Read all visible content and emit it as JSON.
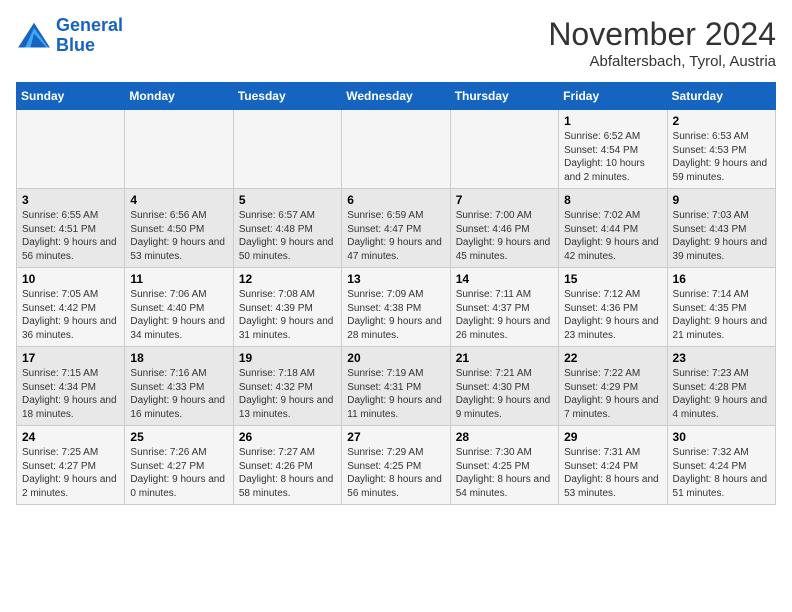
{
  "logo": {
    "line1": "General",
    "line2": "Blue"
  },
  "title": "November 2024",
  "location": "Abfaltersbach, Tyrol, Austria",
  "days_of_week": [
    "Sunday",
    "Monday",
    "Tuesday",
    "Wednesday",
    "Thursday",
    "Friday",
    "Saturday"
  ],
  "weeks": [
    [
      {
        "day": "",
        "info": ""
      },
      {
        "day": "",
        "info": ""
      },
      {
        "day": "",
        "info": ""
      },
      {
        "day": "",
        "info": ""
      },
      {
        "day": "",
        "info": ""
      },
      {
        "day": "1",
        "info": "Sunrise: 6:52 AM\nSunset: 4:54 PM\nDaylight: 10 hours and 2 minutes."
      },
      {
        "day": "2",
        "info": "Sunrise: 6:53 AM\nSunset: 4:53 PM\nDaylight: 9 hours and 59 minutes."
      }
    ],
    [
      {
        "day": "3",
        "info": "Sunrise: 6:55 AM\nSunset: 4:51 PM\nDaylight: 9 hours and 56 minutes."
      },
      {
        "day": "4",
        "info": "Sunrise: 6:56 AM\nSunset: 4:50 PM\nDaylight: 9 hours and 53 minutes."
      },
      {
        "day": "5",
        "info": "Sunrise: 6:57 AM\nSunset: 4:48 PM\nDaylight: 9 hours and 50 minutes."
      },
      {
        "day": "6",
        "info": "Sunrise: 6:59 AM\nSunset: 4:47 PM\nDaylight: 9 hours and 47 minutes."
      },
      {
        "day": "7",
        "info": "Sunrise: 7:00 AM\nSunset: 4:46 PM\nDaylight: 9 hours and 45 minutes."
      },
      {
        "day": "8",
        "info": "Sunrise: 7:02 AM\nSunset: 4:44 PM\nDaylight: 9 hours and 42 minutes."
      },
      {
        "day": "9",
        "info": "Sunrise: 7:03 AM\nSunset: 4:43 PM\nDaylight: 9 hours and 39 minutes."
      }
    ],
    [
      {
        "day": "10",
        "info": "Sunrise: 7:05 AM\nSunset: 4:42 PM\nDaylight: 9 hours and 36 minutes."
      },
      {
        "day": "11",
        "info": "Sunrise: 7:06 AM\nSunset: 4:40 PM\nDaylight: 9 hours and 34 minutes."
      },
      {
        "day": "12",
        "info": "Sunrise: 7:08 AM\nSunset: 4:39 PM\nDaylight: 9 hours and 31 minutes."
      },
      {
        "day": "13",
        "info": "Sunrise: 7:09 AM\nSunset: 4:38 PM\nDaylight: 9 hours and 28 minutes."
      },
      {
        "day": "14",
        "info": "Sunrise: 7:11 AM\nSunset: 4:37 PM\nDaylight: 9 hours and 26 minutes."
      },
      {
        "day": "15",
        "info": "Sunrise: 7:12 AM\nSunset: 4:36 PM\nDaylight: 9 hours and 23 minutes."
      },
      {
        "day": "16",
        "info": "Sunrise: 7:14 AM\nSunset: 4:35 PM\nDaylight: 9 hours and 21 minutes."
      }
    ],
    [
      {
        "day": "17",
        "info": "Sunrise: 7:15 AM\nSunset: 4:34 PM\nDaylight: 9 hours and 18 minutes."
      },
      {
        "day": "18",
        "info": "Sunrise: 7:16 AM\nSunset: 4:33 PM\nDaylight: 9 hours and 16 minutes."
      },
      {
        "day": "19",
        "info": "Sunrise: 7:18 AM\nSunset: 4:32 PM\nDaylight: 9 hours and 13 minutes."
      },
      {
        "day": "20",
        "info": "Sunrise: 7:19 AM\nSunset: 4:31 PM\nDaylight: 9 hours and 11 minutes."
      },
      {
        "day": "21",
        "info": "Sunrise: 7:21 AM\nSunset: 4:30 PM\nDaylight: 9 hours and 9 minutes."
      },
      {
        "day": "22",
        "info": "Sunrise: 7:22 AM\nSunset: 4:29 PM\nDaylight: 9 hours and 7 minutes."
      },
      {
        "day": "23",
        "info": "Sunrise: 7:23 AM\nSunset: 4:28 PM\nDaylight: 9 hours and 4 minutes."
      }
    ],
    [
      {
        "day": "24",
        "info": "Sunrise: 7:25 AM\nSunset: 4:27 PM\nDaylight: 9 hours and 2 minutes."
      },
      {
        "day": "25",
        "info": "Sunrise: 7:26 AM\nSunset: 4:27 PM\nDaylight: 9 hours and 0 minutes."
      },
      {
        "day": "26",
        "info": "Sunrise: 7:27 AM\nSunset: 4:26 PM\nDaylight: 8 hours and 58 minutes."
      },
      {
        "day": "27",
        "info": "Sunrise: 7:29 AM\nSunset: 4:25 PM\nDaylight: 8 hours and 56 minutes."
      },
      {
        "day": "28",
        "info": "Sunrise: 7:30 AM\nSunset: 4:25 PM\nDaylight: 8 hours and 54 minutes."
      },
      {
        "day": "29",
        "info": "Sunrise: 7:31 AM\nSunset: 4:24 PM\nDaylight: 8 hours and 53 minutes."
      },
      {
        "day": "30",
        "info": "Sunrise: 7:32 AM\nSunset: 4:24 PM\nDaylight: 8 hours and 51 minutes."
      }
    ]
  ]
}
